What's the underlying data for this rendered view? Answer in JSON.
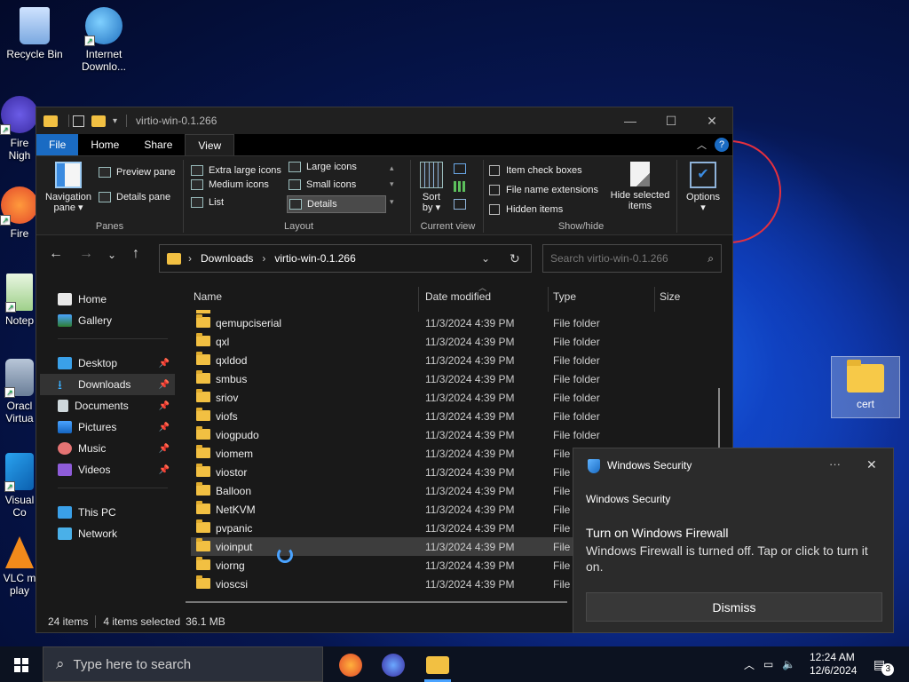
{
  "desktop": {
    "icons": [
      {
        "label": "Recycle Bin",
        "icon": "recycle-bin-icon"
      },
      {
        "label": "Internet Downlo...",
        "icon": "idm-icon"
      },
      {
        "label": "Fire Nigh",
        "icon": "firefox-nightly-icon"
      },
      {
        "label": "Fire",
        "icon": "firefox-icon"
      },
      {
        "label": "Notep",
        "icon": "notepad-icon"
      },
      {
        "label": "Oracl Virtua",
        "icon": "virtualbox-icon"
      },
      {
        "label": "Visual Co",
        "icon": "vscode-icon"
      },
      {
        "label": "VLC m play",
        "icon": "vlc-icon"
      }
    ],
    "cert_folder": "cert"
  },
  "explorer": {
    "title": "virtio-win-0.1.266",
    "menu": {
      "file": "File",
      "home": "Home",
      "share": "Share",
      "view": "View"
    },
    "ribbon": {
      "panes": {
        "label": "Panes",
        "navigation_pane": "Navigation",
        "navigation_pane2": "pane ▾",
        "preview_pane": "Preview pane",
        "details_pane": "Details pane"
      },
      "layout": {
        "label": "Layout",
        "items": [
          "Extra large icons",
          "Large icons",
          "Medium icons",
          "Small icons",
          "List",
          "Details"
        ],
        "selected": "Details"
      },
      "current_view": {
        "label": "Current view",
        "sort_by": "Sort",
        "sort_by2": "by ▾"
      },
      "show_hide": {
        "label": "Show/hide",
        "item_check_boxes": "Item check boxes",
        "file_name_extensions": "File name extensions",
        "hidden_items": "Hidden items",
        "hide_selected": "Hide selected",
        "hide_selected2": "items"
      },
      "options": "Options"
    },
    "breadcrumb": [
      "Downloads",
      "virtio-win-0.1.266"
    ],
    "search_placeholder": "Search virtio-win-0.1.266",
    "nav": {
      "home": "Home",
      "gallery": "Gallery",
      "desktop": "Desktop",
      "downloads": "Downloads",
      "documents": "Documents",
      "pictures": "Pictures",
      "music": "Music",
      "videos": "Videos",
      "this_pc": "This PC",
      "network": "Network"
    },
    "columns": {
      "name": "Name",
      "date": "Date modified",
      "type": "Type",
      "size": "Size"
    },
    "rows": [
      {
        "name": "qemupciserial",
        "date": "11/3/2024 4:39 PM",
        "type": "File folder"
      },
      {
        "name": "qxl",
        "date": "11/3/2024 4:39 PM",
        "type": "File folder"
      },
      {
        "name": "qxldod",
        "date": "11/3/2024 4:39 PM",
        "type": "File folder"
      },
      {
        "name": "smbus",
        "date": "11/3/2024 4:39 PM",
        "type": "File folder"
      },
      {
        "name": "sriov",
        "date": "11/3/2024 4:39 PM",
        "type": "File folder"
      },
      {
        "name": "viofs",
        "date": "11/3/2024 4:39 PM",
        "type": "File folder"
      },
      {
        "name": "viogpudo",
        "date": "11/3/2024 4:39 PM",
        "type": "File folder"
      },
      {
        "name": "viomem",
        "date": "11/3/2024 4:39 PM",
        "type": "File f"
      },
      {
        "name": "viostor",
        "date": "11/3/2024 4:39 PM",
        "type": "File f"
      },
      {
        "name": "Balloon",
        "date": "11/3/2024 4:39 PM",
        "type": "File f"
      },
      {
        "name": "NetKVM",
        "date": "11/3/2024 4:39 PM",
        "type": "File f"
      },
      {
        "name": "pvpanic",
        "date": "11/3/2024 4:39 PM",
        "type": "File f"
      },
      {
        "name": "vioinput",
        "date": "11/3/2024 4:39 PM",
        "type": "File f"
      },
      {
        "name": "viorng",
        "date": "11/3/2024 4:39 PM",
        "type": "File f"
      },
      {
        "name": "vioscsi",
        "date": "11/3/2024 4:39 PM",
        "type": "File f"
      }
    ],
    "status": {
      "count": "24 items",
      "selected": "4 items selected",
      "size": "36.1 MB"
    }
  },
  "toast": {
    "app": "Windows Security",
    "more": "···",
    "header": "Windows Security",
    "title": "Turn on Windows Firewall",
    "body": "Windows Firewall is turned off. Tap or click to turn it on.",
    "dismiss": "Dismiss"
  },
  "taskbar": {
    "search_placeholder": "Type here to search",
    "time": "12:24 AM",
    "date": "12/6/2024",
    "notification_count": "3"
  },
  "colors": {
    "accent": "#1a6bc3",
    "folder": "#f2c042",
    "annotation": "#e4303e"
  }
}
